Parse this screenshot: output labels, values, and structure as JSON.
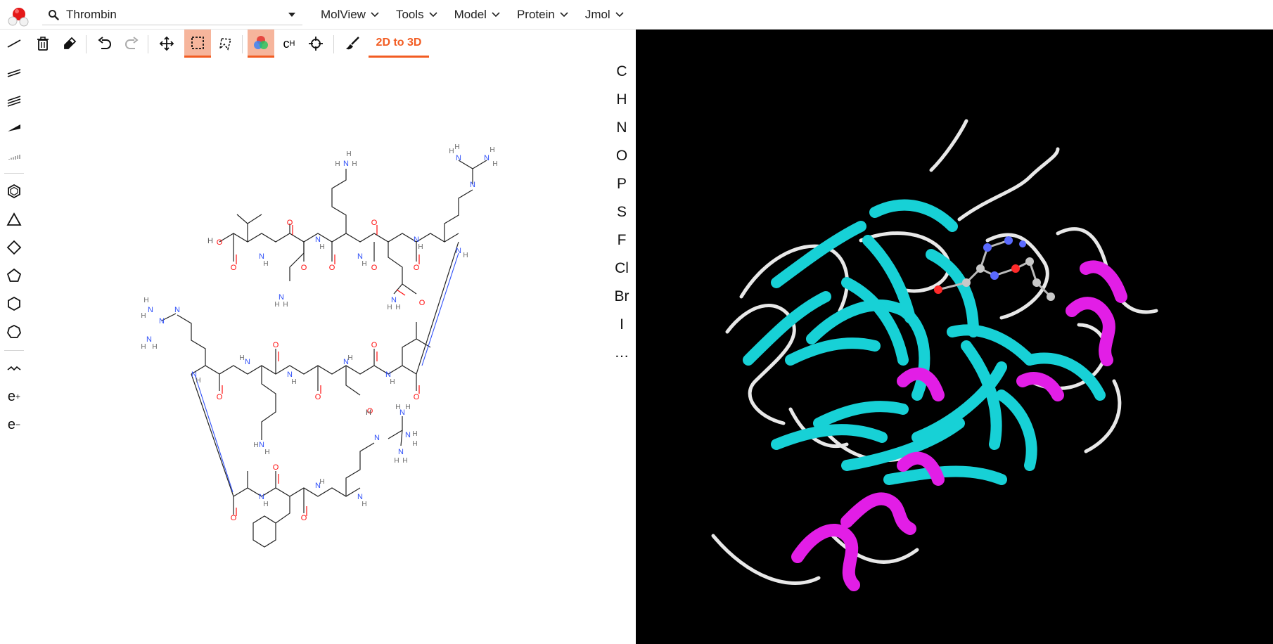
{
  "app": {
    "logo": "molecule-logo-icon"
  },
  "search": {
    "value": "Thrombin",
    "icon": "search-icon"
  },
  "menus": [
    {
      "label": "MolView"
    },
    {
      "label": "Tools"
    },
    {
      "label": "Model"
    },
    {
      "label": "Protein"
    },
    {
      "label": "Jmol"
    }
  ],
  "toolbar": {
    "icons": [
      "trash-icon",
      "eraser-icon",
      "undo-icon",
      "redo-icon",
      "move-icon",
      "rect-select-icon",
      "lasso-select-icon",
      "color-mode-icon",
      "hydrogen-icon",
      "center-icon",
      "clean-icon"
    ],
    "active": [
      "rect-select-icon",
      "color-mode-icon"
    ],
    "convert_label": "2D to 3D",
    "hydrogen_text": "c",
    "hydrogen_sup": "H"
  },
  "left_tools": {
    "icons": [
      "single-bond-icon",
      "double-bond-icon",
      "triple-bond-icon",
      "wedge-bond-icon",
      "hash-bond-icon",
      "benzene-icon",
      "triangle-ring-icon",
      "square-ring-icon",
      "pentagon-ring-icon",
      "hexagon-ring-icon",
      "heptagon-ring-icon",
      "chain-icon"
    ],
    "charge_plus": "e",
    "charge_plus_sup": "+",
    "charge_minus": "e",
    "charge_minus_sup": "−"
  },
  "elements": [
    "C",
    "H",
    "N",
    "O",
    "P",
    "S",
    "F",
    "Cl",
    "Br",
    "I",
    "…"
  ],
  "colors": {
    "accent": "#f25c22",
    "accent_bg": "#f6b59c",
    "nitrogen": "#3050f8",
    "oxygen": "#ff0d0d",
    "bond": "#222222",
    "hydrogen": "#7a7a7a",
    "viewer_bg": "#000000",
    "strand": "#17d1d6",
    "helix": "#e21ee6",
    "coil": "#e8e8e8"
  }
}
